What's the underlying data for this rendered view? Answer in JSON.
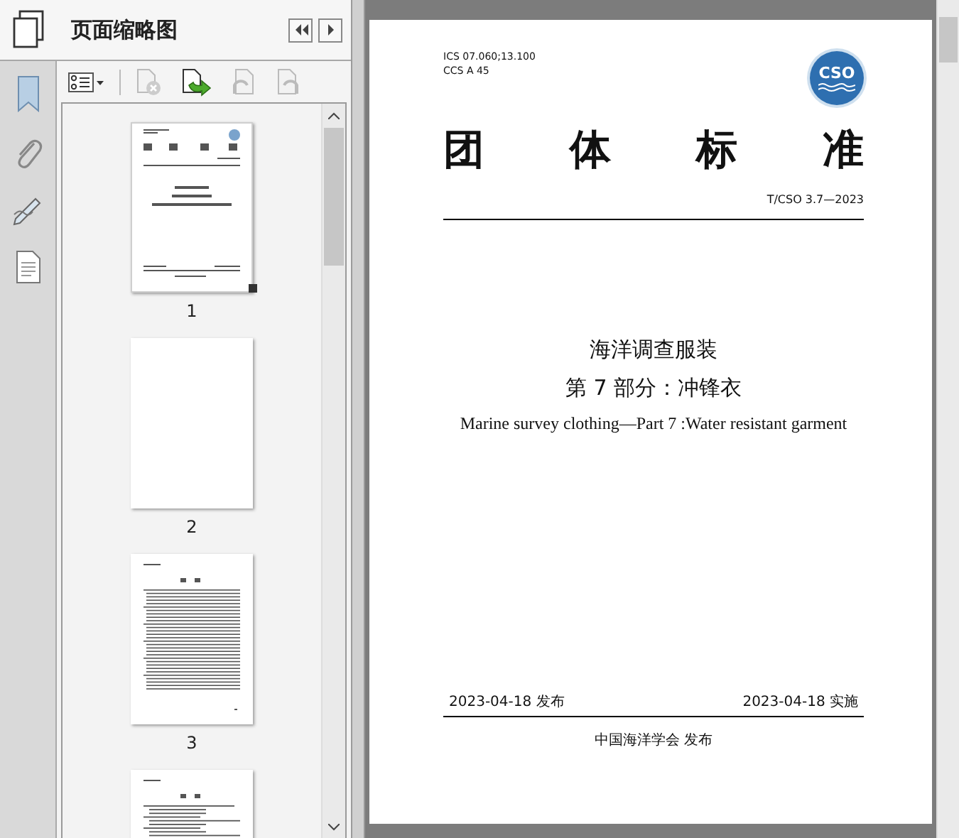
{
  "panel": {
    "title": "页面缩略图"
  },
  "thumbnails": [
    {
      "kind": "cover",
      "label": "1",
      "selected": true
    },
    {
      "kind": "blank",
      "label": "2",
      "selected": false
    },
    {
      "kind": "contents",
      "label": "3",
      "selected": false
    },
    {
      "kind": "text",
      "selected": false
    }
  ],
  "page": {
    "classification": [
      "ICS 07.060;13.100",
      "CCS A 45"
    ],
    "logo": "CSO",
    "heading": [
      "团",
      "体",
      "标",
      "准"
    ],
    "code": "T/CSO 3.7—2023",
    "title_lines": [
      "海洋调查服装",
      "第 7 部分：冲锋衣",
      "Marine survey clothing—Part 7 :Water resistant garment"
    ],
    "issued": "2023-04-18 发布",
    "effective": "2023-04-18 实施",
    "publisher": "中国海洋学会 发布"
  }
}
